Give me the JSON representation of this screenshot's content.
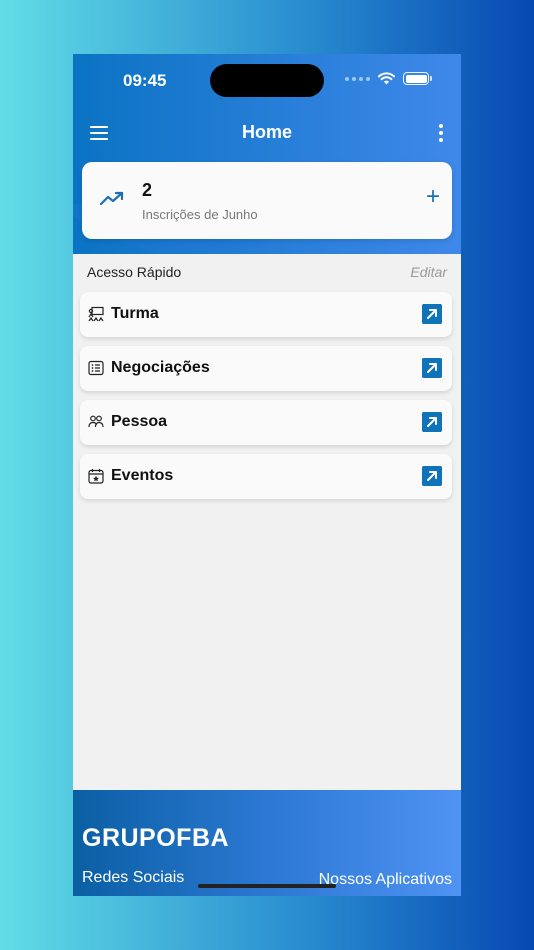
{
  "status_bar": {
    "time": "09:45"
  },
  "nav": {
    "title": "Home",
    "menu_icon": "hamburger-menu-icon",
    "more_icon": "more-vertical-icon"
  },
  "stat_card": {
    "value": "2",
    "label": "Inscrições de Junho",
    "icon": "trending-up-icon",
    "action_icon": "plus-icon"
  },
  "quick_access": {
    "title": "Acesso Rápido",
    "edit_label": "Editar",
    "items": [
      {
        "label": "Turma",
        "icon": "classroom-icon"
      },
      {
        "label": "Negociações",
        "icon": "list-icon"
      },
      {
        "label": "Pessoa",
        "icon": "people-icon"
      },
      {
        "label": "Eventos",
        "icon": "calendar-star-icon"
      }
    ]
  },
  "footer": {
    "brand": "GRUPOFBA",
    "left_link": "Redes Sociais",
    "right_link": "Nossos Aplicativos"
  },
  "colors": {
    "accent": "#0e73b8",
    "header_start": "#0b73c3",
    "header_end": "#3f88ea"
  }
}
